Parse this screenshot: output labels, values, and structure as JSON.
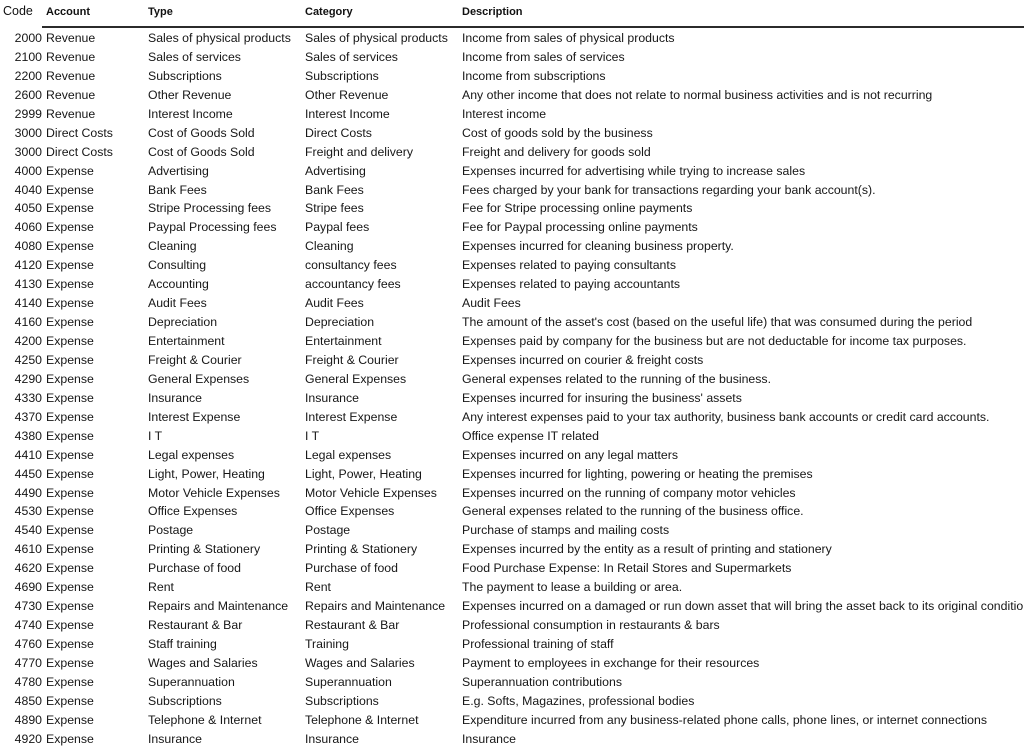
{
  "table": {
    "headers": {
      "code": "Code",
      "account": "Account",
      "type": "Type",
      "category": "Category",
      "description": "Description"
    },
    "rows": [
      {
        "code": "2000",
        "account": "Revenue",
        "type": "Sales of physical products",
        "category": "Sales of physical products",
        "description": "Income from sales of physical products"
      },
      {
        "code": "2100",
        "account": "Revenue",
        "type": "Sales of services",
        "category": "Sales of services",
        "description": "Income from sales of services"
      },
      {
        "code": "2200",
        "account": "Revenue",
        "type": "Subscriptions",
        "category": "Subscriptions",
        "description": "Income from subscriptions"
      },
      {
        "code": "2600",
        "account": "Revenue",
        "type": "Other Revenue",
        "category": "Other Revenue",
        "description": "Any other income that does not relate to normal business activities and is not recurring"
      },
      {
        "code": "2999",
        "account": "Revenue",
        "type": "Interest Income",
        "category": "Interest Income",
        "description": "Interest income"
      },
      {
        "code": "3000",
        "account": "Direct Costs",
        "type": "Cost of Goods Sold",
        "category": "Direct Costs",
        "description": "Cost of goods sold by the business"
      },
      {
        "code": "3000",
        "account": "Direct Costs",
        "type": "Cost of Goods Sold",
        "category": "Freight and delivery",
        "description": "Freight and delivery for goods sold"
      },
      {
        "code": "4000",
        "account": "Expense",
        "type": "Advertising",
        "category": "Advertising",
        "description": "Expenses incurred for advertising while trying to increase sales"
      },
      {
        "code": "4040",
        "account": "Expense",
        "type": "Bank Fees",
        "category": "Bank Fees",
        "description": "Fees charged by your bank for transactions regarding your bank account(s)."
      },
      {
        "code": "4050",
        "account": "Expense",
        "type": "Stripe Processing fees",
        "category": "Stripe fees",
        "description": "Fee for Stripe processing online payments"
      },
      {
        "code": "4060",
        "account": "Expense",
        "type": "Paypal Processing fees",
        "category": "Paypal fees",
        "description": "Fee for Paypal processing online payments"
      },
      {
        "code": "4080",
        "account": "Expense",
        "type": "Cleaning",
        "category": "Cleaning",
        "description": "Expenses incurred for cleaning  business property."
      },
      {
        "code": "4120",
        "account": "Expense",
        "type": "Consulting",
        "category": "consultancy fees",
        "description": "Expenses related to paying consultants"
      },
      {
        "code": "4130",
        "account": "Expense",
        "type": "Accounting",
        "category": "accountancy fees",
        "description": "Expenses related to paying accountants"
      },
      {
        "code": "4140",
        "account": "Expense",
        "type": "Audit Fees",
        "category": "Audit Fees",
        "description": "Audit Fees"
      },
      {
        "code": "4160",
        "account": "Expense",
        "type": "Depreciation",
        "category": "Depreciation",
        "description": "The amount of the asset's cost (based on the useful life) that was consumed during the period"
      },
      {
        "code": "4200",
        "account": "Expense",
        "type": "Entertainment",
        "category": "Entertainment",
        "description": "Expenses paid by company for the business but are not deductable for income tax purposes."
      },
      {
        "code": "4250",
        "account": "Expense",
        "type": "Freight & Courier",
        "category": "Freight & Courier",
        "description": "Expenses incurred on courier & freight costs"
      },
      {
        "code": "4290",
        "account": "Expense",
        "type": "General Expenses",
        "category": "General Expenses",
        "description": "General expenses related to the running of the business."
      },
      {
        "code": "4330",
        "account": "Expense",
        "type": "Insurance",
        "category": "Insurance",
        "description": "Expenses incurred for insuring the business' assets"
      },
      {
        "code": "4370",
        "account": "Expense",
        "type": "Interest Expense",
        "category": "Interest Expense",
        "description": "Any interest expenses paid to your tax authority, business bank accounts or credit card accounts."
      },
      {
        "code": "4380",
        "account": "Expense",
        "type": "I T",
        "category": "I T",
        "description": "Office expense IT related"
      },
      {
        "code": "4410",
        "account": "Expense",
        "type": "Legal expenses",
        "category": "Legal expenses",
        "description": "Expenses incurred on any legal matters"
      },
      {
        "code": "4450",
        "account": "Expense",
        "type": "Light, Power, Heating",
        "category": "Light, Power, Heating",
        "description": "Expenses incurred for lighting, powering or heating the premises"
      },
      {
        "code": "4490",
        "account": "Expense",
        "type": "Motor Vehicle Expenses",
        "category": "Motor Vehicle Expenses",
        "description": "Expenses incurred on the running of company motor vehicles"
      },
      {
        "code": "4530",
        "account": "Expense",
        "type": "Office Expenses",
        "category": "Office Expenses",
        "description": "General expenses related to the running of the business office."
      },
      {
        "code": "4540",
        "account": "Expense",
        "type": "Postage",
        "category": "Postage",
        "description": "Purchase of stamps and mailing costs"
      },
      {
        "code": "4610",
        "account": "Expense",
        "type": "Printing & Stationery",
        "category": "Printing & Stationery",
        "description": "Expenses incurred by the entity as a result of printing and stationery"
      },
      {
        "code": "4620",
        "account": "Expense",
        "type": "Purchase of food",
        "category": "Purchase of food",
        "description": "Food Purchase Expense: In Retail Stores and Supermarkets"
      },
      {
        "code": "4690",
        "account": "Expense",
        "type": "Rent",
        "category": "Rent",
        "description": "The payment to lease a building or area."
      },
      {
        "code": "4730",
        "account": "Expense",
        "type": "Repairs and Maintenance",
        "category": "Repairs and Maintenance",
        "description": "Expenses incurred on a damaged or run down asset that will bring the asset back to its original condition."
      },
      {
        "code": "4740",
        "account": "Expense",
        "type": "Restaurant & Bar",
        "category": "Restaurant & Bar",
        "description": "Professional consumption in restaurants & bars"
      },
      {
        "code": "4760",
        "account": "Expense",
        "type": "Staff training",
        "category": "Training",
        "description": "Professional training of staff"
      },
      {
        "code": "4770",
        "account": "Expense",
        "type": "Wages and Salaries",
        "category": "Wages and Salaries",
        "description": "Payment to employees in exchange for their resources"
      },
      {
        "code": "4780",
        "account": "Expense",
        "type": "Superannuation",
        "category": "Superannuation",
        "description": "Superannuation contributions"
      },
      {
        "code": "4850",
        "account": "Expense",
        "type": "Subscriptions",
        "category": "Subscriptions",
        "description": "E.g. Softs, Magazines, professional bodies"
      },
      {
        "code": "4890",
        "account": "Expense",
        "type": "Telephone & Internet",
        "category": "Telephone & Internet",
        "description": "Expenditure incurred from any business-related phone calls, phone lines, or internet connections"
      },
      {
        "code": "4920",
        "account": "Expense",
        "type": "Insurance",
        "category": "Insurance",
        "description": "Insurance"
      }
    ]
  }
}
